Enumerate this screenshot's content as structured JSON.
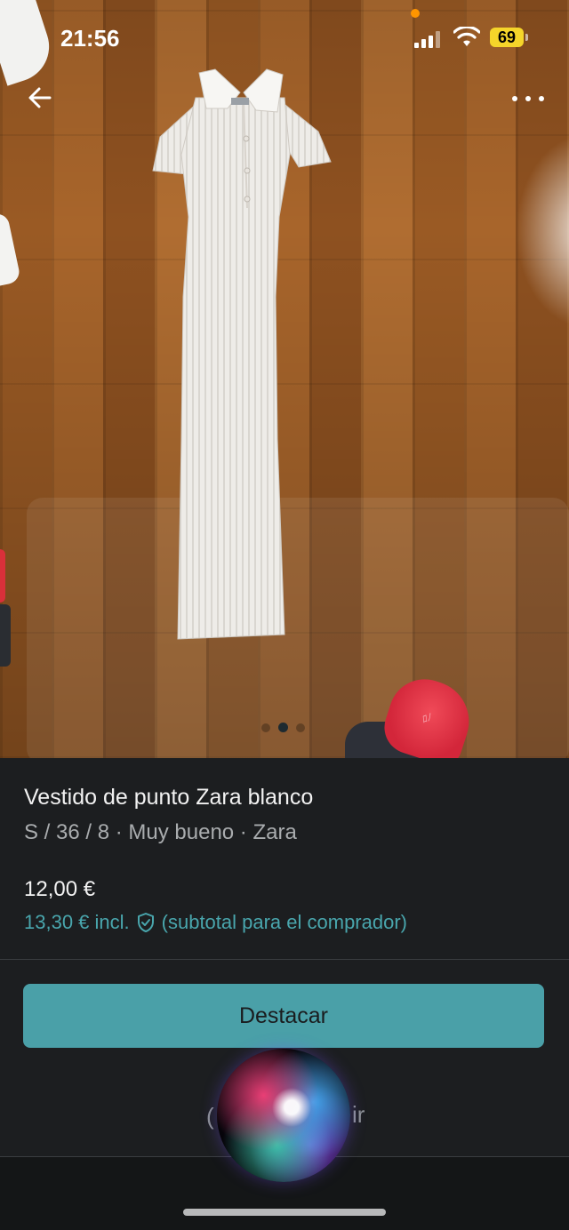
{
  "status_bar": {
    "time": "21:56",
    "battery": "69"
  },
  "photo": {
    "pagination_total": 3,
    "pagination_active": 1
  },
  "listing": {
    "title": "Vestido de punto Zara blanco",
    "subtitle": "S / 36 / 8 · Muy bueno · Zara",
    "price": "12,00 €",
    "price_incl_prefix": "13,30 € incl.",
    "price_incl_suffix": "(subtotal para el comprador)"
  },
  "actions": {
    "highlight_label": "Destacar",
    "hidden_left_fragment": "(",
    "hidden_right_fragment": "ir"
  },
  "colors": {
    "accent": "#4aa0a8",
    "price_incl": "#49a6ad",
    "panel_bg": "#1c1e20",
    "battery": "#f5d52a"
  },
  "icons": [
    "back-arrow-icon",
    "more-dots-icon",
    "shield-check-icon",
    "signal-icon",
    "wifi-icon",
    "battery-icon",
    "siri-orb"
  ]
}
